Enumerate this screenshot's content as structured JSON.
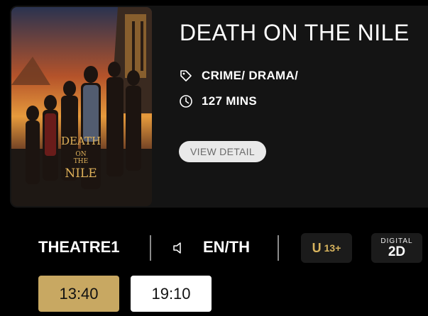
{
  "movie": {
    "title": "DEATH ON THE NILE",
    "genre": "CRIME/ DRAMA/",
    "duration": "127 MINS",
    "detail_button": "VIEW DETAIL",
    "poster_title_lines": [
      "DEATH",
      "ON",
      "THE",
      "NILE"
    ],
    "icons": [
      "tag-icon",
      "clock-icon"
    ]
  },
  "session": {
    "theatre": "THEATRE1",
    "language": "EN/TH",
    "rating_letter": "U",
    "rating_age": "13+",
    "format_top": "DIGITAL",
    "format_main": "2D",
    "icons": [
      "speaker-icon"
    ]
  },
  "showtimes": [
    {
      "time": "13:40",
      "selected": true
    },
    {
      "time": "19:10",
      "selected": false
    }
  ],
  "colors": {
    "background": "#000000",
    "card": "#141414",
    "accent_gold": "#c8a862",
    "badge_text": "#d8b45e"
  }
}
